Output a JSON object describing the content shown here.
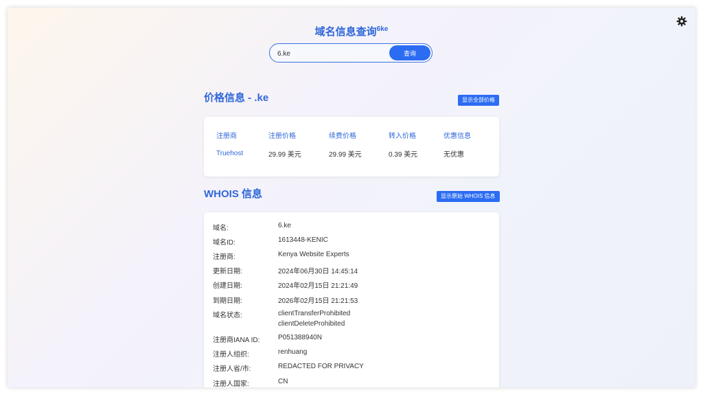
{
  "app": {
    "title": "域名信息查询",
    "title_suffix": "6ke"
  },
  "search": {
    "value": "6.ke",
    "button_label": "查询"
  },
  "price_section": {
    "title": "价格信息 - .ke",
    "show_all_label": "显示全部价格",
    "headers": [
      "注册商",
      "注册价格",
      "续费价格",
      "转入价格",
      "优惠信息"
    ],
    "rows": [
      [
        "Truehost",
        "29.99 美元",
        "29.99 美元",
        "0.39 美元",
        "无优惠"
      ]
    ]
  },
  "whois_section": {
    "title": "WHOIS 信息",
    "show_raw_label": "显示原始 WHOIS 信息",
    "fields": [
      {
        "label": "域名:",
        "value": "6.ke"
      },
      {
        "label": "域名ID:",
        "value": "1613448-KENIC"
      },
      {
        "label": "注册商:",
        "value": "Kenya Website Experts"
      },
      {
        "label": "更新日期:",
        "value": "2024年06月30日 14:45:14"
      },
      {
        "label": "创建日期:",
        "value": "2024年02月15日 21:21:49"
      },
      {
        "label": "到期日期:",
        "value": "2026年02月15日 21:21:53"
      },
      {
        "label": "域名状态:",
        "value": [
          "clientTransferProhibited",
          "clientDeleteProhibited"
        ]
      },
      {
        "label": "注册商IANA ID:",
        "value": "P051388940N"
      },
      {
        "label": "注册人组织:",
        "value": "renhuang"
      },
      {
        "label": "注册人省/市:",
        "value": "REDACTED FOR PRIVACY"
      },
      {
        "label": "注册人国家:",
        "value": "CN"
      }
    ]
  },
  "colors": {
    "accent": "#2f67d9",
    "button": "#2b6cf2"
  },
  "icons": {
    "settings": "gear-icon"
  }
}
